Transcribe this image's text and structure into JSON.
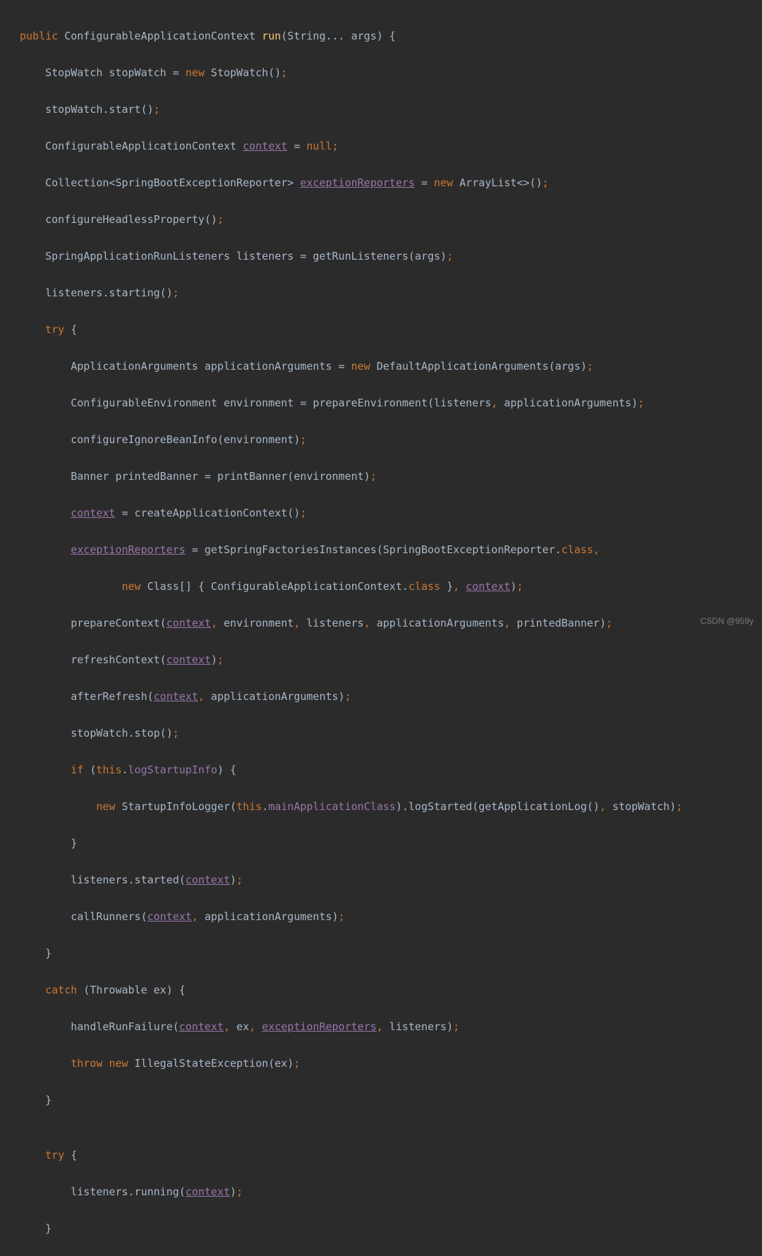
{
  "watermark": "CSDN @959y",
  "kw": {
    "public": "public",
    "new": "new",
    "null": "null",
    "try": "try",
    "if": "if",
    "this": "this",
    "catch": "catch",
    "throw": "throw",
    "class": "class"
  },
  "method": {
    "name": "run"
  },
  "field": {
    "context": "context",
    "exceptionReporters": "exceptionReporters",
    "logStartupInfo": "logStartupInfo",
    "mainApplicationClass": "mainApplicationClass"
  },
  "t": {
    "l1a": " ConfigurableApplicationContext ",
    "l1b": "(String... args) {",
    "l2a": "    StopWatch stopWatch = ",
    "l2b": " StopWatch()",
    "semi": ";",
    "l3": "    stopWatch.start()",
    "l4a": "    ConfigurableApplicationContext ",
    "l4b": " = ",
    "l5a": "    Collection<SpringBootExceptionReporter> ",
    "l5b": " = ",
    "l5c": " ArrayList<>()",
    "l6": "    configureHeadlessProperty()",
    "l7": "    SpringApplicationRunListeners listeners = getRunListeners(args)",
    "l8": "    listeners.starting()",
    "l9a": "    ",
    "l9b": " {",
    "l10a": "        ApplicationArguments applicationArguments = ",
    "l10b": " DefaultApplicationArguments(args)",
    "l11": "        ConfigurableEnvironment environment = prepareEnvironment(listeners",
    "l11b": " applicationArguments)",
    "l12": "        configureIgnoreBeanInfo(environment)",
    "l13": "        Banner printedBanner = printBanner(environment)",
    "l14a": "        ",
    "l14b": " = createApplicationContext()",
    "l15a": "        ",
    "l15b": " = getSpringFactoriesInstances(SpringBootExceptionReporter.",
    "comma": ",",
    "l16a": "                ",
    "l16b": " Class[] { ConfigurableApplicationContext.",
    "l16c": " }",
    "l16d": " ",
    "l16e": ")",
    "l17a": "        prepareContext(",
    "l17b": " environment",
    "l17c": " listeners",
    "l17d": " applicationArguments",
    "l17e": " printedBanner)",
    "l18a": "        refreshContext(",
    "l18b": ")",
    "l19a": "        afterRefresh(",
    "l19b": " applicationArguments)",
    "l20": "        stopWatch.stop()",
    "l21a": "        ",
    "l21b": " (",
    "l21c": ".",
    "l21d": ") {",
    "l22a": "            ",
    "l22b": " StartupInfoLogger(",
    "l22c": ".",
    "l22d": ").logStarted(getApplicationLog()",
    "l22e": " stopWatch)",
    "l23": "        }",
    "l24a": "        listeners.started(",
    "l24b": ")",
    "l25a": "        callRunners(",
    "l25b": " applicationArguments)",
    "l26": "    }",
    "l27a": "    ",
    "l27b": " (Throwable ex) {",
    "l28a": "        handleRunFailure(",
    "l28b": " ex",
    "l28d": " listeners)",
    "l29a": "        ",
    "l29b": " ",
    "l29c": " IllegalStateException(ex)",
    "l30": "    }",
    "blank": "",
    "l31a": "    ",
    "l31b": " {",
    "l32a": "        listeners.running(",
    "l32b": ")",
    "l33": "    }"
  }
}
